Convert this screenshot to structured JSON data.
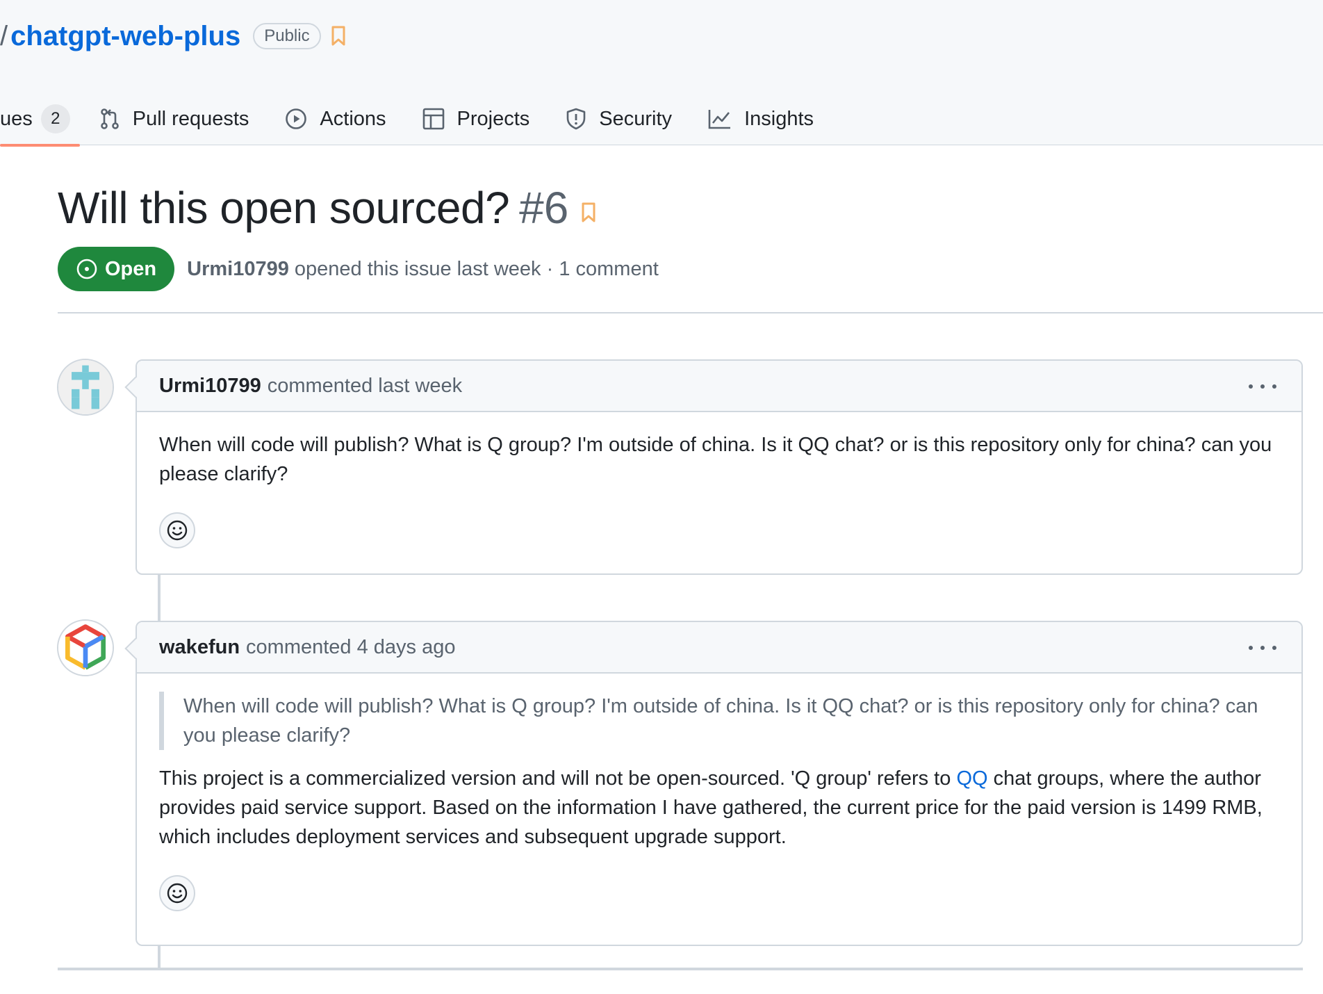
{
  "repo": {
    "slash": "/",
    "name": "chatgpt-web-plus",
    "visibility": "Public"
  },
  "tabs": [
    {
      "label": "ues",
      "counter": "2"
    },
    {
      "label": "Pull requests"
    },
    {
      "label": "Actions"
    },
    {
      "label": "Projects"
    },
    {
      "label": "Security"
    },
    {
      "label": "Insights"
    }
  ],
  "issue": {
    "title": "Will this open sourced?",
    "number": "#6",
    "state": "Open",
    "author": "Urmi10799",
    "meta": "opened this issue last week · 1 comment"
  },
  "comments": [
    {
      "author": "Urmi10799",
      "action": "commented last week",
      "body": "When will code will publish? What is Q group? I'm outside of china. Is it QQ chat? or is this repository only for china? can you please clarify?"
    },
    {
      "author": "wakefun",
      "action": "commented 4 days ago",
      "quote": "When will code will publish? What is Q group? I'm outside of china. Is it QQ chat? or is this repository only for china? can you please clarify?",
      "body_before_link": "This project is a commercialized version and will not be open-sourced. 'Q group' refers to ",
      "link_text": "QQ",
      "body_after_link": " chat groups, where the author provides paid service support. Based on the information I have gathered, the current price for the paid version is 1499 RMB, which includes deployment services and subsequent upgrade support."
    }
  ],
  "colors": {
    "accent": "#0969da",
    "open_state": "#1f883d",
    "active_tab_underline": "#fd8c73",
    "bookmark": "#f4b066"
  },
  "icons": [
    "bookmark-icon",
    "pull-request-icon",
    "actions-play-icon",
    "projects-table-icon",
    "shield-icon",
    "graph-icon",
    "issue-open-icon",
    "kebab-icon",
    "smiley-icon"
  ]
}
